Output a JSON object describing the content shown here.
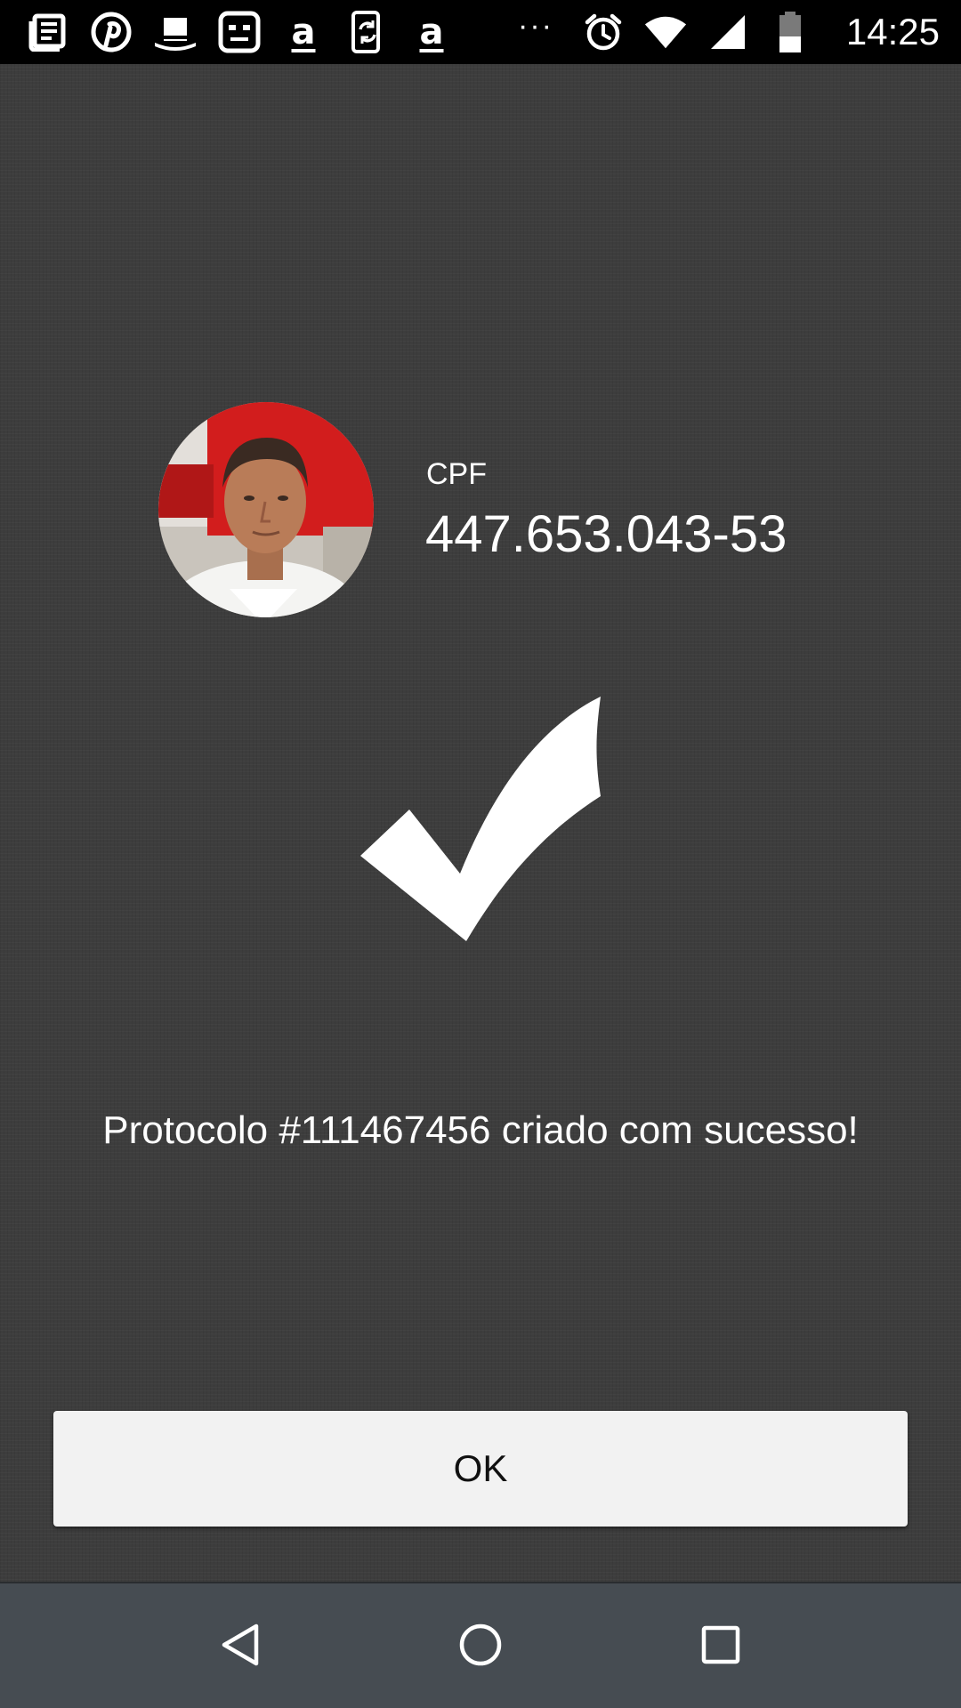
{
  "status_bar": {
    "left_icons": [
      "news-icon",
      "pinterest-icon",
      "top-hat-icon",
      "robot-face-icon",
      "amazon-icon",
      "phone-sync-icon",
      "amazon-icon"
    ],
    "overflow_indicator": "···",
    "right_icons": [
      "alarm-icon",
      "wifi-icon",
      "cell-signal-icon",
      "battery-icon"
    ],
    "time": "14:25",
    "amazon_glyph": "a"
  },
  "profile": {
    "cpf_label": "CPF",
    "cpf_value": "447.653.043-53"
  },
  "message": "Protocolo #111467456 criado com sucesso!",
  "ok_button_label": "OK",
  "nav_bar": {
    "buttons": [
      "back-icon",
      "home-icon",
      "recents-icon"
    ]
  },
  "colors": {
    "background": "#3d3d3d",
    "status_bar": "#000000",
    "nav_bar": "#464c52",
    "button": "#f2f2f2",
    "text": "#ffffff"
  }
}
